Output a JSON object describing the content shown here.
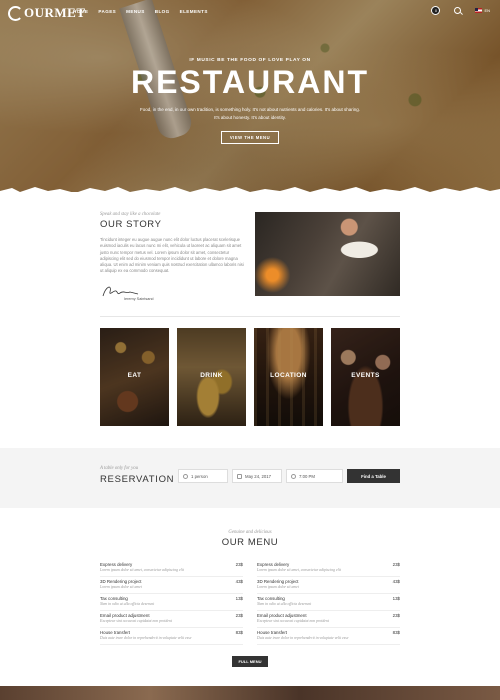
{
  "nav": {
    "logo": "OURMET",
    "items": [
      "HOME",
      "PAGES",
      "MENUS",
      "BLOG",
      "ELEMENTS"
    ],
    "cart_count": "0",
    "lang": "EN"
  },
  "hero": {
    "kicker": "IF MUSIC BE THE FOOD OF LOVE PLAY ON",
    "title": "RESTAURANT",
    "text": "Food, in the end, in our own tradition, is something holy. It's not about nutrients and calories. It's about sharing. It's about honesty. It's about identity.",
    "button": "VIEW THE MENU"
  },
  "story": {
    "script": "Speak and stay like a chocolate",
    "title": "OUR STORY",
    "text": "Tincidunt integer eu augue augue nunc elit dolor luctus placerat scelerisque euismod iaculis eu lacus nunc mi elit, vehicula ut laoreet ac aliquam sit amet justo nunc tempor metus vel. Lorem ipsum dolor sit amet, consectetur adipiscing elit sed do eiusmod tempor incididunt ut labore et dolore magna aliqua. Ut enim ad minim veniam quis nostrud exercitation ullamco laboris nisi ut aliquip ex ea commodo consequat.",
    "signature_name": "Ieremy Saintsand"
  },
  "tiles": [
    "EAT",
    "DRINK",
    "LOCATION",
    "EVENTS"
  ],
  "reservation": {
    "script": "A table only for you",
    "title": "RESERVATION",
    "persons": "1 person",
    "date": "May 24, 2017",
    "time": "7:00 PM",
    "button": "Find a Table"
  },
  "menu": {
    "script": "Genuine and delicious",
    "title": "OUR MENU",
    "button": "FULL MENU",
    "left": [
      {
        "name": "Express delivery",
        "price": "23$",
        "desc": "Lorem ipsum dolor sit amet, consectetur adipiscing elit"
      },
      {
        "name": "3D Rendering project",
        "price": "43$",
        "desc": "Lorem ipsum dolor sit amet"
      },
      {
        "name": "Tax consulting",
        "price": "13$",
        "desc": "Nam in odio ut ulla officia deserunt"
      },
      {
        "name": "Email product adjustment",
        "price": "23$",
        "desc": "Excepteur sint occaecat cupidatat non proident"
      },
      {
        "name": "House transfert",
        "price": "83$",
        "desc": "Duis aute irure dolor in reprehenderit in voluptate velit esse"
      }
    ],
    "right": [
      {
        "name": "Express delivery",
        "price": "23$",
        "desc": "Lorem ipsum dolor sit amet, consectetur adipiscing elit"
      },
      {
        "name": "3D Rendering project",
        "price": "43$",
        "desc": "Lorem ipsum dolor sit amet"
      },
      {
        "name": "Tax consulting",
        "price": "13$",
        "desc": "Nam in odio ut ulla officia deserunt"
      },
      {
        "name": "Email product adjustment",
        "price": "23$",
        "desc": "Excepteur sint occaecat cupidatat non proident"
      },
      {
        "name": "House transfert",
        "price": "83$",
        "desc": "Duis aute irure dolor in reprehenderit in voluptate velit esse"
      }
    ]
  }
}
